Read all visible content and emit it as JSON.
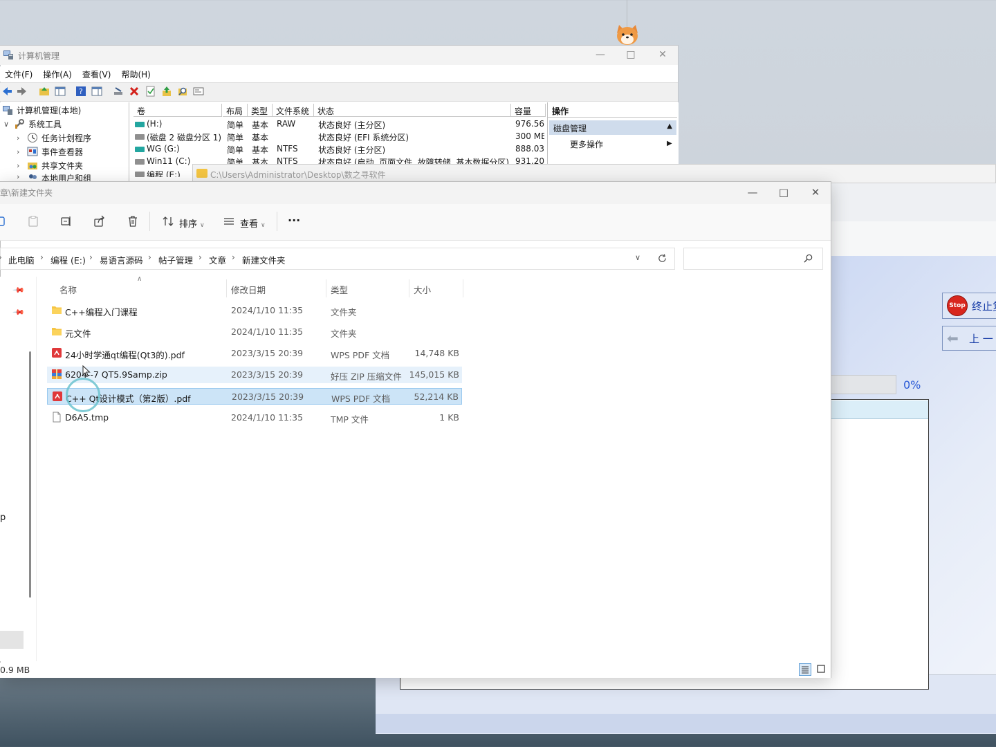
{
  "computer_management": {
    "title": "计算机管理",
    "menu": [
      "文件(F)",
      "操作(A)",
      "查看(V)",
      "帮助(H)"
    ],
    "tree": {
      "root": "计算机管理(本地)",
      "system_tools": "系统工具",
      "children": [
        "任务计划程序",
        "事件查看器",
        "共享文件夹",
        "本地用户和组"
      ]
    },
    "columns": [
      "卷",
      "布局",
      "类型",
      "文件系统",
      "状态",
      "容量"
    ],
    "volumes": [
      {
        "name": "(H:)",
        "layout": "简单",
        "type": "基本",
        "fs": "RAW",
        "status": "状态良好 (主分区)",
        "capacity": "976.56"
      },
      {
        "name": "(磁盘 2 磁盘分区 1)",
        "layout": "简单",
        "type": "基本",
        "fs": "",
        "status": "状态良好 (EFI 系统分区)",
        "capacity": "300 MB"
      },
      {
        "name": "WG (G:)",
        "layout": "简单",
        "type": "基本",
        "fs": "NTFS",
        "status": "状态良好 (主分区)",
        "capacity": "888.03"
      },
      {
        "name": "Win11 (C:)",
        "layout": "简单",
        "type": "基本",
        "fs": "NTFS",
        "status": "状态良好 (启动, 页面文件, 故障转储, 基本数据分区)",
        "capacity": "931.20"
      },
      {
        "name": "编程 (E:)",
        "layout": "",
        "type": "",
        "fs": "",
        "status": "",
        "capacity": ""
      }
    ],
    "actions": {
      "header": "操作",
      "selected": "磁盘管理",
      "more": "更多操作"
    }
  },
  "background_window": {
    "path": "C:\\Users\\Administrator\\Desktop\\数之寻软件"
  },
  "explorer": {
    "title": "章\\新建文件夹",
    "toolbar": {
      "sort_label": "排序",
      "view_label": "查看",
      "more_label": "···"
    },
    "breadcrumb": [
      "此电脑",
      "编程 (E:)",
      "易语言源码",
      "帖子管理",
      "文章",
      "新建文件夹"
    ],
    "search_placeholder": "",
    "nav_partial_label": "p",
    "columns": {
      "name": "名称",
      "modified": "修改日期",
      "type": "类型",
      "size": "大小"
    },
    "files": [
      {
        "name": "C++编程入门课程",
        "modified": "2024/1/10 11:35",
        "type": "文件夹",
        "size": "",
        "icon": "folder-icon"
      },
      {
        "name": "元文件",
        "modified": "2024/1/10 11:35",
        "type": "文件夹",
        "size": "",
        "icon": "folder-icon"
      },
      {
        "name": "24小时学通qt编程(Qt3的).pdf",
        "modified": "2023/3/15 20:39",
        "type": "WPS PDF 文档",
        "size": "14,748 KB",
        "icon": "pdf-icon"
      },
      {
        "name": "6204--7 QT5.9Samp.zip",
        "modified": "2023/3/15 20:39",
        "type": "好压 ZIP 压缩文件",
        "size": "145,015 KB",
        "icon": "zip-icon"
      },
      {
        "name": "C++  Qt设计模式（第2版）.pdf",
        "modified": "2023/3/15 20:39",
        "type": "WPS PDF 文档",
        "size": "52,214 KB",
        "icon": "pdf-icon"
      },
      {
        "name": "D6A5.tmp",
        "modified": "2024/1/10 11:35",
        "type": "TMP 文件",
        "size": "1 KB",
        "icon": "file-icon"
      }
    ],
    "status": "0.9 MB"
  },
  "right_app": {
    "stop_badge": "Stop",
    "stop_label": "终止复",
    "prev_label": "上 一",
    "progress_percent": 0,
    "progress_text": "0%"
  }
}
